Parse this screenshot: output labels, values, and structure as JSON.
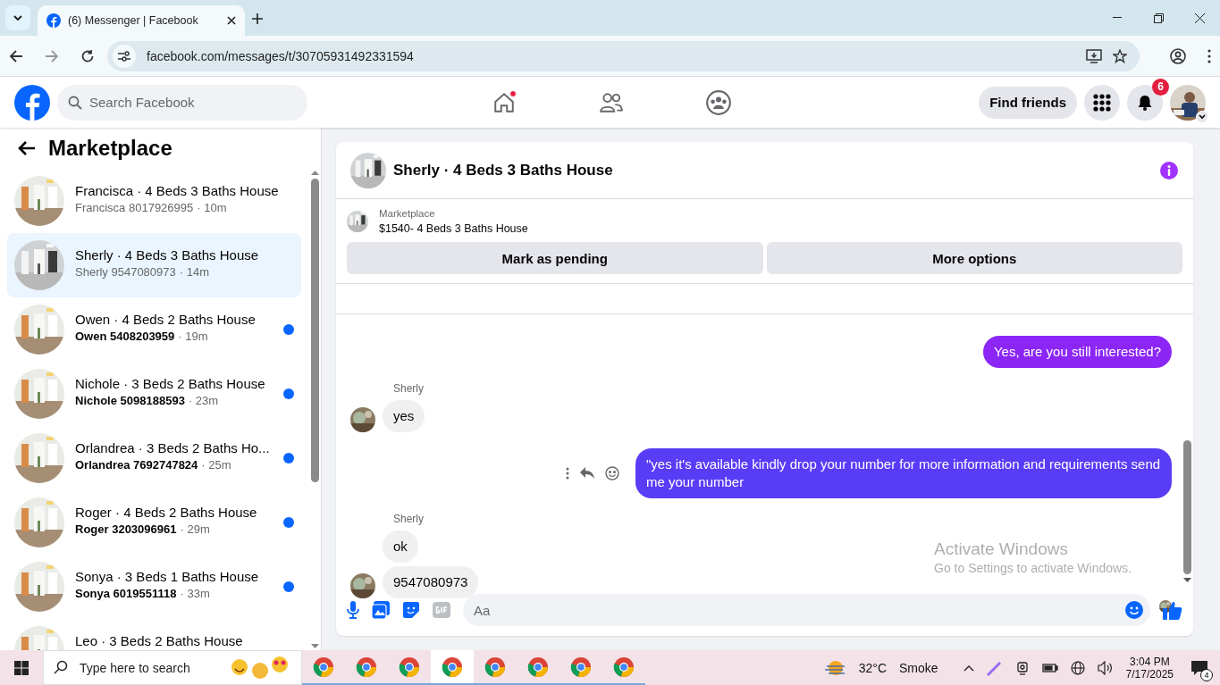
{
  "browser": {
    "tab_title": "(6) Messenger | Facebook",
    "url": "facebook.com/messages/t/30705931492331594"
  },
  "header": {
    "search": {
      "placeholder": "Search Facebook"
    },
    "nav": [
      {
        "kind": "home",
        "notify": true
      },
      {
        "kind": "friends",
        "notify": false
      },
      {
        "kind": "groups",
        "notify": false
      }
    ],
    "find_friends": "Find friends",
    "notifications_count": "6"
  },
  "sidebar": {
    "title": "Marketplace",
    "conversations": [
      {
        "title": "Francisca · 4 Beds 3 Baths House",
        "subtitle": "Francisca 8017926995",
        "time": "· 10m",
        "selected": false,
        "unread": false
      },
      {
        "title": "Sherly · 4 Beds 3 Baths House",
        "subtitle": "Sherly 9547080973",
        "time": "· 14m",
        "selected": true,
        "unread": false
      },
      {
        "title": "Owen · 4 Beds 2 Baths House",
        "subtitle": "Owen 5408203959",
        "time": "· 19m",
        "selected": false,
        "unread": true
      },
      {
        "title": "Nichole · 3 Beds 2 Baths House",
        "subtitle": "Nichole 5098188593",
        "time": "· 23m",
        "selected": false,
        "unread": true
      },
      {
        "title": "Orlandrea · 3 Beds 2 Baths Ho...",
        "subtitle": "Orlandrea 7692747824",
        "time": "· 25m",
        "selected": false,
        "unread": true
      },
      {
        "title": "Roger · 4 Beds 2 Baths House",
        "subtitle": "Roger 3203096961",
        "time": "· 29m",
        "selected": false,
        "unread": true
      },
      {
        "title": "Sonya · 3 Beds 1 Baths House",
        "subtitle": "Sonya 6019551118",
        "time": "· 33m",
        "selected": false,
        "unread": true
      },
      {
        "title": "Leo · 3 Beds 2 Baths House",
        "selected": false
      }
    ]
  },
  "chat": {
    "title": "Sherly · 4 Beds 3 Baths House",
    "listing": {
      "label": "Marketplace",
      "name": "$1540- 4 Beds 3 Baths House"
    },
    "actions": [
      "Mark as pending",
      "More options"
    ],
    "messages": [
      {
        "kind": "sent",
        "text": "Yes, are you still interested?"
      },
      {
        "kind": "received",
        "sender": "Sherly",
        "text": "yes",
        "avatar": true
      },
      {
        "kind": "sent",
        "text": "\"yes it's available kindly drop your number for more information and requirements send me your number",
        "hovered": true
      },
      {
        "kind": "received",
        "sender": "Sherly",
        "text": "ok",
        "avatar": false
      },
      {
        "kind": "received",
        "text": "9547080973",
        "avatar": true
      }
    ],
    "composer": {
      "placeholder": "Aa"
    }
  },
  "os_notice": {
    "title": "Activate Windows",
    "text": "Go to Settings to activate Windows."
  },
  "taskbar": {
    "search_placeholder": "Type here to search",
    "apps": [
      {
        "selected": false
      },
      {
        "selected": false
      },
      {
        "selected": false
      },
      {
        "selected": true
      },
      {
        "selected": false
      },
      {
        "selected": false
      },
      {
        "selected": false
      },
      {
        "selected": false
      }
    ],
    "weather": {
      "temp": "32°C",
      "condition": "Smoke"
    },
    "time": "3:04 PM",
    "date": "7/17/2025",
    "notification_count": "4"
  }
}
